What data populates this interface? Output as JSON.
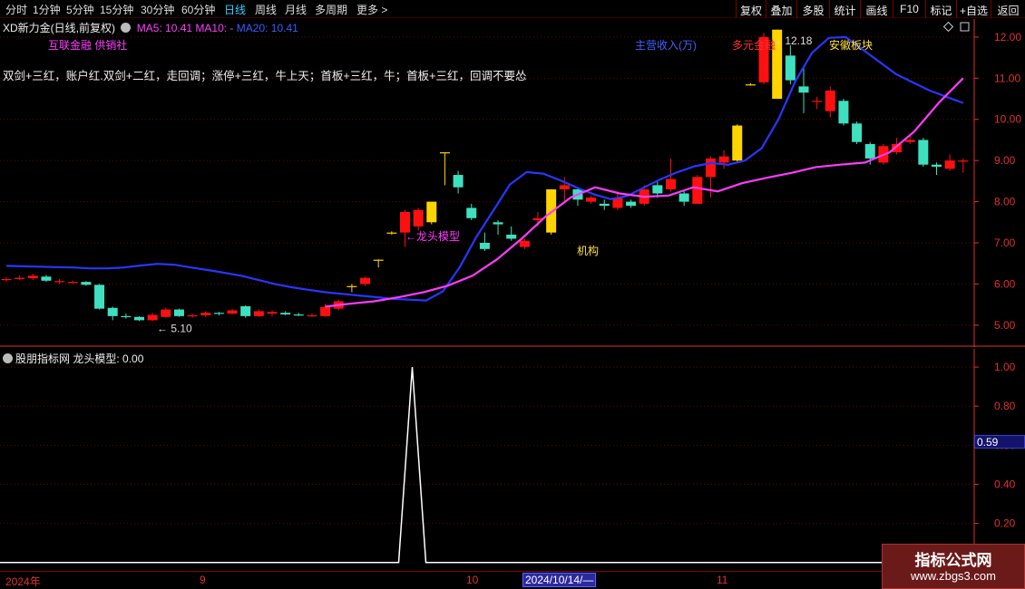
{
  "toolbar": {
    "periods": [
      "分时",
      "1分钟",
      "5分钟",
      "15分钟",
      "30分钟",
      "60分钟",
      "日线",
      "周线",
      "月线",
      "多周期",
      "更多"
    ],
    "more_arrow": ">",
    "active_period": "日线",
    "buttons": [
      "复权",
      "叠加",
      "多股",
      "统计",
      "画线",
      "F10",
      "标记",
      "+自选",
      "返回"
    ]
  },
  "main_panel": {
    "stock_title": "XD新力金",
    "mode": "(日线,前复权)",
    "ma_indicators": [
      {
        "label": "MA5: 10.41",
        "color": "#ff3cff"
      },
      {
        "label": "MA10: -",
        "color": "#ff3cff"
      },
      {
        "label": "MA20: 10.41",
        "color": "#3a5cff"
      }
    ],
    "concept_tags": "互联金融 供销社",
    "scrolling_text": "双剑+三红，账户红.双剑+二红，走回调；涨停+三红，牛上天；首板+三红，牛；首板+三红，回调不要怂",
    "annotations": {
      "dragon_head": "龙头模型",
      "institution": "机构",
      "main_revenue": "主营收入(万)",
      "diversified_finance": "多元金融",
      "anhui_sector": "安徽板块",
      "high_price": "12.18",
      "low_price": "5.10",
      "arrow": "←"
    },
    "corner_icons": [
      "diamond-icon",
      "square-icon"
    ]
  },
  "sub_panel": {
    "title": "股朋指标网",
    "indicator": "龙头模型: 0.00",
    "scale_badge": "0.59"
  },
  "date_axis": {
    "labels": [
      "2024年",
      "9",
      "10",
      "11"
    ],
    "selected": "2024/10/14/—"
  },
  "watermark": {
    "title": "指标公式网",
    "url": "www.zbgs3.com"
  },
  "colors": {
    "up": "#ff1010",
    "down": "#3fe0c0",
    "limit_up": "#ffd400",
    "ma5": "#ff3cff",
    "ma20": "#2a36ff",
    "axis": "#e03030",
    "grid": "#6a0000"
  },
  "chart_data": [
    {
      "type": "candlestick",
      "title": "XD新力金 日线",
      "y_ticks": [
        5.0,
        6.0,
        7.0,
        8.0,
        9.0,
        10.0,
        11.0,
        12.0
      ],
      "ylim": [
        4.6,
        12.35
      ],
      "candles": [
        {
          "o": 6.1,
          "c": 6.12,
          "h": 6.17,
          "l": 6.06
        },
        {
          "o": 6.12,
          "c": 6.15,
          "h": 6.2,
          "l": 6.1
        },
        {
          "o": 6.14,
          "c": 6.2,
          "h": 6.25,
          "l": 6.1
        },
        {
          "o": 6.18,
          "c": 6.08,
          "h": 6.22,
          "l": 6.05
        },
        {
          "o": 6.05,
          "c": 6.07,
          "h": 6.12,
          "l": 6.0
        },
        {
          "o": 6.05,
          "c": 6.05,
          "h": 6.08,
          "l": 6.02
        },
        {
          "o": 6.05,
          "c": 5.98,
          "h": 6.07,
          "l": 5.96
        },
        {
          "o": 5.98,
          "c": 5.4,
          "h": 6.0,
          "l": 5.38
        },
        {
          "o": 5.42,
          "c": 5.22,
          "h": 5.45,
          "l": 5.12
        },
        {
          "o": 5.22,
          "c": 5.2,
          "h": 5.28,
          "l": 5.16
        },
        {
          "o": 5.2,
          "c": 5.12,
          "h": 5.22,
          "l": 5.1
        },
        {
          "o": 5.12,
          "c": 5.25,
          "h": 5.3,
          "l": 5.1
        },
        {
          "o": 5.2,
          "c": 5.38,
          "h": 5.42,
          "l": 5.18
        },
        {
          "o": 5.38,
          "c": 5.22,
          "h": 5.4,
          "l": 5.2
        },
        {
          "o": 5.22,
          "c": 5.24,
          "h": 5.28,
          "l": 5.18
        },
        {
          "o": 5.24,
          "c": 5.3,
          "h": 5.34,
          "l": 5.2
        },
        {
          "o": 5.3,
          "c": 5.28,
          "h": 5.32,
          "l": 5.24
        },
        {
          "o": 5.28,
          "c": 5.36,
          "h": 5.4,
          "l": 5.26
        },
        {
          "o": 5.46,
          "c": 5.22,
          "h": 5.48,
          "l": 5.18
        },
        {
          "o": 5.22,
          "c": 5.34,
          "h": 5.38,
          "l": 5.2
        },
        {
          "o": 5.28,
          "c": 5.32,
          "h": 5.36,
          "l": 5.22
        },
        {
          "o": 5.3,
          "c": 5.26,
          "h": 5.34,
          "l": 5.24
        },
        {
          "o": 5.26,
          "c": 5.25,
          "h": 5.3,
          "l": 5.22
        },
        {
          "o": 5.22,
          "c": 5.24,
          "h": 5.28,
          "l": 5.2
        },
        {
          "o": 5.22,
          "c": 5.44,
          "h": 5.52,
          "l": 5.2
        },
        {
          "o": 5.4,
          "c": 5.58,
          "h": 5.62,
          "l": 5.36
        },
        {
          "o": 5.95,
          "c": 5.95,
          "h": 6.0,
          "l": 5.8,
          "limit": true
        },
        {
          "o": 6.0,
          "c": 6.15,
          "h": 6.18,
          "l": 5.95
        },
        {
          "o": 6.59,
          "c": 6.59,
          "h": 6.6,
          "l": 6.4,
          "limit": true
        },
        {
          "o": 7.25,
          "c": 7.25,
          "h": 7.28,
          "l": 7.2,
          "limit": true
        },
        {
          "o": 7.25,
          "c": 7.75,
          "h": 7.8,
          "l": 6.9
        },
        {
          "o": 7.4,
          "c": 7.8,
          "h": 7.85,
          "l": 7.3
        },
        {
          "o": 7.5,
          "c": 8.0,
          "h": 8.0,
          "l": 7.45,
          "limit": true
        },
        {
          "o": 9.2,
          "c": 9.2,
          "h": 9.2,
          "l": 8.4,
          "limit": true
        },
        {
          "o": 8.65,
          "c": 8.35,
          "h": 8.75,
          "l": 8.2
        },
        {
          "o": 7.85,
          "c": 7.6,
          "h": 7.95,
          "l": 7.55
        },
        {
          "o": 7.0,
          "c": 6.85,
          "h": 7.25,
          "l": 6.8
        },
        {
          "o": 7.5,
          "c": 7.45,
          "h": 7.55,
          "l": 7.2
        },
        {
          "o": 7.2,
          "c": 7.1,
          "h": 7.4,
          "l": 7.05
        },
        {
          "o": 6.9,
          "c": 7.05,
          "h": 7.1,
          "l": 6.85
        },
        {
          "o": 7.55,
          "c": 7.6,
          "h": 7.75,
          "l": 7.4
        },
        {
          "o": 7.25,
          "c": 8.3,
          "h": 8.3,
          "l": 7.2,
          "limit": true
        },
        {
          "o": 8.3,
          "c": 8.4,
          "h": 8.6,
          "l": 8.0
        },
        {
          "o": 8.3,
          "c": 8.05,
          "h": 8.35,
          "l": 7.9
        },
        {
          "o": 8.0,
          "c": 8.1,
          "h": 8.15,
          "l": 7.95
        },
        {
          "o": 7.95,
          "c": 7.9,
          "h": 8.05,
          "l": 7.8
        },
        {
          "o": 7.85,
          "c": 8.1,
          "h": 8.25,
          "l": 7.8
        },
        {
          "o": 8.0,
          "c": 7.9,
          "h": 8.05,
          "l": 7.85
        },
        {
          "o": 7.95,
          "c": 8.3,
          "h": 8.4,
          "l": 7.9
        },
        {
          "o": 8.4,
          "c": 8.2,
          "h": 8.5,
          "l": 8.1
        },
        {
          "o": 8.3,
          "c": 8.55,
          "h": 9.05,
          "l": 8.25
        },
        {
          "o": 8.2,
          "c": 8.0,
          "h": 8.25,
          "l": 7.9
        },
        {
          "o": 7.95,
          "c": 8.6,
          "h": 8.65,
          "l": 7.95
        },
        {
          "o": 8.6,
          "c": 9.05,
          "h": 9.1,
          "l": 8.1
        },
        {
          "o": 8.95,
          "c": 9.1,
          "h": 9.25,
          "l": 8.8
        },
        {
          "o": 9.0,
          "c": 9.85,
          "h": 9.88,
          "l": 8.95,
          "limit": true
        },
        {
          "o": 10.85,
          "c": 10.85,
          "h": 10.88,
          "l": 10.82,
          "limit": true
        },
        {
          "o": 10.9,
          "c": 12.0,
          "h": 12.1,
          "l": 10.85
        },
        {
          "o": 10.5,
          "c": 12.18,
          "h": 12.18,
          "l": 10.5,
          "limit": true
        },
        {
          "o": 11.55,
          "c": 10.95,
          "h": 11.8,
          "l": 10.85
        },
        {
          "o": 10.8,
          "c": 10.65,
          "h": 11.25,
          "l": 10.15
        },
        {
          "o": 10.45,
          "c": 10.45,
          "h": 10.55,
          "l": 10.25
        },
        {
          "o": 10.2,
          "c": 10.7,
          "h": 10.8,
          "l": 10.05
        },
        {
          "o": 10.45,
          "c": 9.9,
          "h": 10.5,
          "l": 9.85
        },
        {
          "o": 9.9,
          "c": 9.45,
          "h": 9.95,
          "l": 9.4
        },
        {
          "o": 9.4,
          "c": 9.05,
          "h": 9.45,
          "l": 8.9
        },
        {
          "o": 8.95,
          "c": 9.35,
          "h": 9.4,
          "l": 8.9
        },
        {
          "o": 9.2,
          "c": 9.4,
          "h": 9.55,
          "l": 9.15
        },
        {
          "o": 9.45,
          "c": 9.5,
          "h": 9.6,
          "l": 9.4
        },
        {
          "o": 9.5,
          "c": 8.9,
          "h": 9.55,
          "l": 8.85
        },
        {
          "o": 8.9,
          "c": 8.85,
          "h": 8.95,
          "l": 8.65
        },
        {
          "o": 8.8,
          "c": 9.0,
          "h": 9.15,
          "l": 8.75
        },
        {
          "o": 9.0,
          "c": 9.0,
          "h": 9.05,
          "l": 8.7
        }
      ],
      "ma20": [
        6.44,
        6.43,
        6.42,
        6.41,
        6.4,
        6.38,
        6.38,
        6.4,
        6.45,
        6.49,
        6.47,
        6.4,
        6.34,
        6.27,
        6.2,
        6.1,
        6.0,
        5.92,
        5.86,
        5.8,
        5.76,
        5.72,
        5.68,
        5.64,
        5.62,
        5.6,
        5.82,
        6.4,
        7.14,
        7.78,
        8.42,
        8.72,
        8.68,
        8.52,
        8.34,
        8.18,
        8.06,
        8.14,
        8.35,
        8.55,
        8.72,
        8.86,
        8.94,
        8.9,
        9.0,
        9.3,
        10.0,
        10.92,
        11.62,
        11.98,
        12.0,
        11.7,
        11.4,
        11.1,
        10.9,
        10.7,
        10.55,
        10.4
      ],
      "ma20_start": 0,
      "ma5_start": 24,
      "ma5": [
        5.45,
        5.52,
        5.58,
        5.68,
        5.8,
        5.96,
        6.2,
        6.6,
        7.1,
        7.65,
        8.1,
        8.35,
        8.2,
        8.12,
        8.15,
        8.35,
        8.25,
        8.45,
        8.58,
        8.7,
        8.84,
        8.9,
        8.95,
        9.2,
        9.7,
        10.4,
        11.0
      ]
    },
    {
      "type": "line",
      "title": "龙头模型",
      "y_ticks": [
        0.2,
        0.4,
        0.6,
        0.8,
        1.0
      ],
      "ylim": [
        -0.02,
        1.07
      ],
      "spike_index": 30,
      "values_note": "0 everywhere except a single spike to 1.00"
    }
  ]
}
